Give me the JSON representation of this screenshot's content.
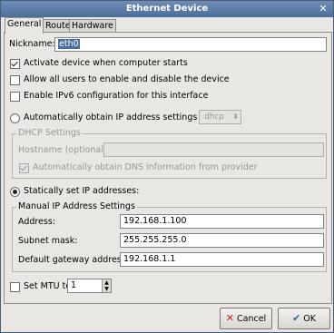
{
  "window": {
    "title": "Ethernet Device",
    "close_glyph": "✕"
  },
  "tabs": [
    {
      "label": "General",
      "active": true
    },
    {
      "label": "Route",
      "active": false
    },
    {
      "label": "Hardware Device",
      "active": false
    }
  ],
  "general": {
    "nickname_label": "Nickname:",
    "nickname_value": "eth0",
    "activate_label": "Activate device when computer starts",
    "activate_checked": true,
    "allow_users_label": "Allow all users to enable and disable the device",
    "allow_users_checked": false,
    "ipv6_label": "Enable IPv6 configuration for this interface",
    "ipv6_checked": false,
    "auto_ip_label": "Automatically obtain IP address settings with:",
    "auto_ip_selected": false,
    "auto_ip_method": "dhcp",
    "dhcp_settings_title": "DHCP Settings",
    "hostname_label": "Hostname (optional):",
    "hostname_value": "",
    "auto_dns_label": "Automatically obtain DNS information from provider",
    "auto_dns_checked": true,
    "static_label": "Statically set IP addresses:",
    "static_selected": true,
    "manual_title": "Manual IP Address Settings",
    "address_label": "Address:",
    "address_value": "192.168.1.100",
    "subnet_label": "Subnet mask:",
    "subnet_value": "255.255.255.0",
    "gateway_label": "Default gateway address:",
    "gateway_value": "192.168.1.1",
    "mtu_label": "Set MTU to:",
    "mtu_checked": false,
    "mtu_value": "1"
  },
  "buttons": {
    "cancel_label": "Cancel",
    "ok_label": "OK"
  }
}
